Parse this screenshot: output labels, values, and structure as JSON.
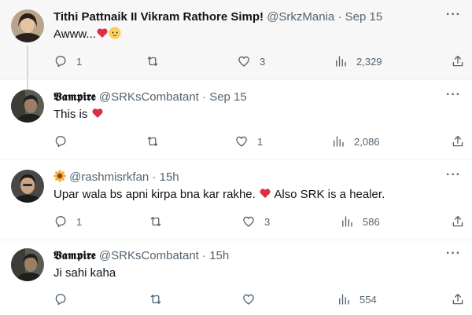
{
  "tweets": [
    {
      "name": "Tithi Pattnaik II Vikram Rathore Simp!",
      "handle": "@SrkzMania",
      "sep": "·",
      "time": "Sep 15",
      "text": "Awww...",
      "emoji": [
        "red-heart",
        "pleading-face"
      ],
      "replies": "1",
      "retweets": "",
      "likes": "3",
      "views": "2,329",
      "highlighted": true
    },
    {
      "name": "𝖁𝖆𝖒𝖕𝖎𝖗𝖊",
      "handle": "@SRKsCombatant",
      "sep": "·",
      "time": "Sep 15",
      "text": "This is",
      "emoji": [
        "red-heart"
      ],
      "replies": "",
      "retweets": "",
      "likes": "1",
      "views": "2,086"
    },
    {
      "name_emoji": "sunflower",
      "handle": "@rashmisrkfan",
      "sep": "·",
      "time": "15h",
      "text": "Upar wala bs apni kirpa bna kar rakhe.",
      "text2": "Also SRK is a healer.",
      "emoji": [
        "red-heart"
      ],
      "replies": "1",
      "retweets": "",
      "likes": "3",
      "views": "586"
    },
    {
      "name": "𝖁𝖆𝖒𝖕𝖎𝖗𝖊",
      "handle": "@SRKsCombatant",
      "sep": "·",
      "time": "15h",
      "text": "Ji sahi kaha",
      "replies": "",
      "retweets": "",
      "likes": "",
      "views": "554"
    }
  ],
  "colors": {
    "text": "#0f1419",
    "secondary": "#536471",
    "heart": "#e0245e",
    "highlight": "#f7f7f7"
  },
  "icons": [
    "reply-icon",
    "retweet-icon",
    "like-icon",
    "views-icon",
    "share-icon",
    "more-icon"
  ]
}
